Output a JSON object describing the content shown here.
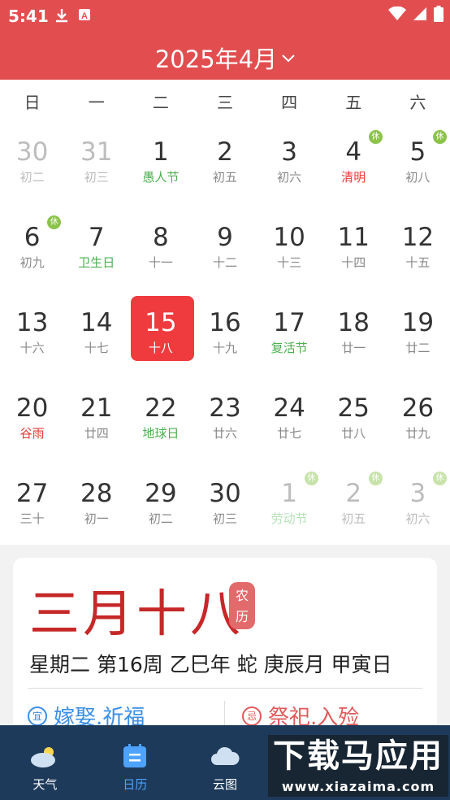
{
  "status": {
    "time": "5:41"
  },
  "header": {
    "title": "2025年4月"
  },
  "weekdays": [
    "日",
    "一",
    "二",
    "三",
    "四",
    "五",
    "六"
  ],
  "weeks": [
    [
      {
        "n": "30",
        "s": "初二",
        "other": true
      },
      {
        "n": "31",
        "s": "初三",
        "other": true
      },
      {
        "n": "1",
        "s": "愚人节",
        "c": "green"
      },
      {
        "n": "2",
        "s": "初五"
      },
      {
        "n": "3",
        "s": "初六"
      },
      {
        "n": "4",
        "s": "清明",
        "c": "red",
        "b": "休"
      },
      {
        "n": "5",
        "s": "初八",
        "b": "休"
      }
    ],
    [
      {
        "n": "6",
        "s": "初九",
        "b": "休"
      },
      {
        "n": "7",
        "s": "卫生日",
        "c": "green"
      },
      {
        "n": "8",
        "s": "十一"
      },
      {
        "n": "9",
        "s": "十二"
      },
      {
        "n": "10",
        "s": "十三"
      },
      {
        "n": "11",
        "s": "十四"
      },
      {
        "n": "12",
        "s": "十五"
      }
    ],
    [
      {
        "n": "13",
        "s": "十六"
      },
      {
        "n": "14",
        "s": "十七"
      },
      {
        "n": "15",
        "s": "十八",
        "sel": true
      },
      {
        "n": "16",
        "s": "十九"
      },
      {
        "n": "17",
        "s": "复活节",
        "c": "green"
      },
      {
        "n": "18",
        "s": "廿一"
      },
      {
        "n": "19",
        "s": "廿二"
      }
    ],
    [
      {
        "n": "20",
        "s": "谷雨",
        "c": "red"
      },
      {
        "n": "21",
        "s": "廿四"
      },
      {
        "n": "22",
        "s": "地球日",
        "c": "green"
      },
      {
        "n": "23",
        "s": "廿六"
      },
      {
        "n": "24",
        "s": "廿七"
      },
      {
        "n": "25",
        "s": "廿八"
      },
      {
        "n": "26",
        "s": "廿九"
      }
    ],
    [
      {
        "n": "27",
        "s": "三十"
      },
      {
        "n": "28",
        "s": "初一"
      },
      {
        "n": "29",
        "s": "初二"
      },
      {
        "n": "30",
        "s": "初三"
      },
      {
        "n": "1",
        "s": "劳动节",
        "c": "green",
        "other": true,
        "b": "休"
      },
      {
        "n": "2",
        "s": "初五",
        "other": true,
        "b": "休"
      },
      {
        "n": "3",
        "s": "初六",
        "other": true,
        "b": "休"
      }
    ]
  ],
  "detail": {
    "lunar_date": "三月十八",
    "lunar_tag_1": "农",
    "lunar_tag_2": "历",
    "ganzhi": "星期二 第16周 乙巳年 蛇 庚辰月 甲寅日",
    "yi_icon": "宜",
    "yi": "嫁娶.祈福",
    "ji_icon": "忌",
    "ji": "祭祀.入殓"
  },
  "nav": [
    {
      "label": "天气",
      "icon": "weather-icon"
    },
    {
      "label": "日历",
      "icon": "calendar-icon",
      "active": true
    },
    {
      "label": "云图",
      "icon": "cloud-icon"
    }
  ],
  "watermark": {
    "main": "下载马应用",
    "sub": "www.xiazaima.com"
  }
}
